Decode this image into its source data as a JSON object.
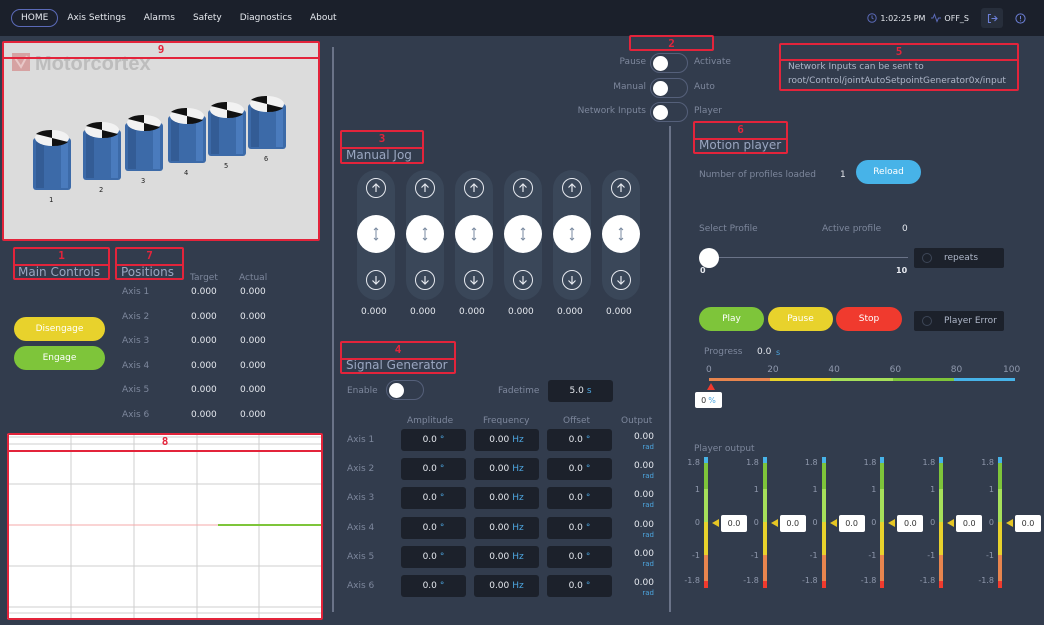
{
  "nav": {
    "tabs": [
      {
        "label": "HOME",
        "active": true
      },
      {
        "label": "Axis Settings",
        "active": false
      },
      {
        "label": "Alarms",
        "active": false
      },
      {
        "label": "Safety",
        "active": false
      },
      {
        "label": "Diagnostics",
        "active": false
      },
      {
        "label": "About",
        "active": false
      }
    ],
    "time": "1:02:25 PM",
    "state": "OFF_S",
    "icons": {
      "clock": "clock-icon",
      "state": "activity-icon",
      "logout": "logout-icon",
      "info": "info-icon"
    }
  },
  "annotations": [
    "1",
    "2",
    "3",
    "4",
    "5",
    "6",
    "7",
    "8",
    "9"
  ],
  "viewport": {
    "logo_text": "Motorcortex",
    "axis_labels": [
      "1",
      "2",
      "3",
      "4",
      "5",
      "6"
    ]
  },
  "main_controls": {
    "title": "Main Controls",
    "disengage_label": "Disengage",
    "engage_label": "Engage",
    "colors": {
      "disengage": "#e8d22c",
      "engage": "#7ec53a"
    }
  },
  "positions": {
    "title": "Positions",
    "headers": {
      "target": "Target",
      "actual": "Actual"
    },
    "rows": [
      {
        "axis": "Axis 1",
        "target": "0.000",
        "actual": "0.000"
      },
      {
        "axis": "Axis 2",
        "target": "0.000",
        "actual": "0.000"
      },
      {
        "axis": "Axis 3",
        "target": "0.000",
        "actual": "0.000"
      },
      {
        "axis": "Axis 4",
        "target": "0.000",
        "actual": "0.000"
      },
      {
        "axis": "Axis 5",
        "target": "0.000",
        "actual": "0.000"
      },
      {
        "axis": "Axis 6",
        "target": "0.000",
        "actual": "0.000"
      }
    ]
  },
  "mode_switches": [
    {
      "left": "Pause",
      "right": "Activate",
      "on": false
    },
    {
      "left": "Manual",
      "right": "Auto",
      "on": false
    },
    {
      "left": "Network Inputs",
      "right": "Player",
      "on": false
    }
  ],
  "network_note": {
    "line1": "Network Inputs can be sent to",
    "line2": "root/Control/jointAutoSetpointGenerator0x/input"
  },
  "manual_jog": {
    "title": "Manual Jog",
    "values": [
      "0.000",
      "0.000",
      "0.000",
      "0.000",
      "0.000",
      "0.000"
    ]
  },
  "signal_generator": {
    "title": "Signal Generator",
    "enable_label": "Enable",
    "enable_on": false,
    "fadetime_label": "Fadetime",
    "fadetime_value": "5.0",
    "fadetime_unit": "s",
    "headers": [
      "Amplitude",
      "Frequency",
      "Offset",
      "Output"
    ],
    "rows": [
      {
        "axis": "Axis 1",
        "amplitude": "0.0",
        "frequency": "0.00",
        "offset": "0.0",
        "output": "0.00"
      },
      {
        "axis": "Axis 2",
        "amplitude": "0.0",
        "frequency": "0.00",
        "offset": "0.0",
        "output": "0.00"
      },
      {
        "axis": "Axis 3",
        "amplitude": "0.0",
        "frequency": "0.00",
        "offset": "0.0",
        "output": "0.00"
      },
      {
        "axis": "Axis 4",
        "amplitude": "0.0",
        "frequency": "0.00",
        "offset": "0.0",
        "output": "0.00"
      },
      {
        "axis": "Axis 5",
        "amplitude": "0.0",
        "frequency": "0.00",
        "offset": "0.0",
        "output": "0.00"
      },
      {
        "axis": "Axis 6",
        "amplitude": "0.0",
        "frequency": "0.00",
        "offset": "0.0",
        "output": "0.00"
      }
    ],
    "units": {
      "amplitude": "°",
      "frequency": "Hz",
      "offset": "°",
      "output": "rad"
    }
  },
  "motion_player": {
    "title": "Motion player",
    "profiles_loaded_label": "Number of profiles loaded",
    "profiles_loaded": "1",
    "reload_label": "Reload",
    "select_profile_label": "Select Profile",
    "active_profile_label": "Active profile",
    "active_profile": "0",
    "slider": {
      "min": "0",
      "max": "10",
      "value": 0
    },
    "repeats_label": "repeats",
    "play_label": "Play",
    "pause_label": "Pause",
    "stop_label": "Stop",
    "player_error_label": "Player Error",
    "progress_label": "Progress",
    "progress_value": "0.0",
    "progress_unit": "s",
    "progress_ticks": [
      "0",
      "20",
      "40",
      "60",
      "80",
      "100"
    ],
    "progress_percent": "0",
    "progress_percent_unit": "%",
    "output_label": "Player output",
    "meter_ticks": [
      "1.8",
      "1",
      "0",
      "-1",
      "-1.8"
    ],
    "meter_values": [
      "0.0",
      "0.0",
      "0.0",
      "0.0",
      "0.0",
      "0.0"
    ],
    "colors": {
      "play": "#7ec53a",
      "pause": "#e8d22c",
      "stop": "#f03a2e",
      "reload": "#47b3e8"
    }
  }
}
